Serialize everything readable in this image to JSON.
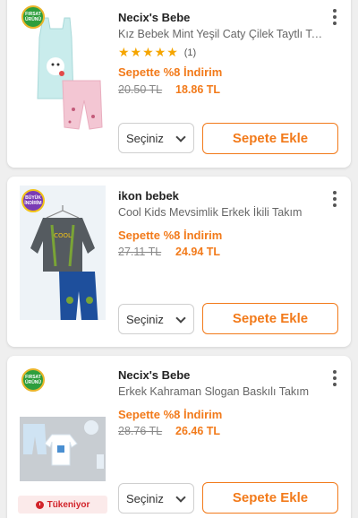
{
  "products": [
    {
      "brand": "Necix's Bebe",
      "name": "Kız Bebek Mint Yeşil Caty Çilek Taytlı Takım",
      "stars": "★★★★★",
      "review_count": "(1)",
      "promo": "Sepette %8 İndirim",
      "old_price": "20.50 TL",
      "new_price": "18.86 TL",
      "variant_select": "Seçiniz",
      "add_to_cart": "Sepete Ekle",
      "badge": "FIRSAT ÜRÜNÜ"
    },
    {
      "brand": "ikon bebek",
      "name": "Cool Kids Mevsimlik Erkek İkili Takım",
      "promo": "Sepette %8 İndirim",
      "old_price": "27.11 TL",
      "new_price": "24.94 TL",
      "variant_select": "Seçiniz",
      "add_to_cart": "Sepete Ekle",
      "badge": "BÜYÜK İNDİRİM"
    },
    {
      "brand": "Necix's Bebe",
      "name": "Erkek Kahraman Slogan Baskılı Takım",
      "promo": "Sepette %8 İndirim",
      "old_price": "28.76 TL",
      "new_price": "26.46 TL",
      "variant_select": "Seçiniz",
      "add_to_cart": "Sepete Ekle",
      "badge": "FIRSAT ÜRÜNÜ",
      "stock_label": "Tükeniyor"
    }
  ],
  "colors": {
    "accent": "#f27a1a",
    "star": "#f5a500",
    "stock_red": "#d2232a"
  }
}
